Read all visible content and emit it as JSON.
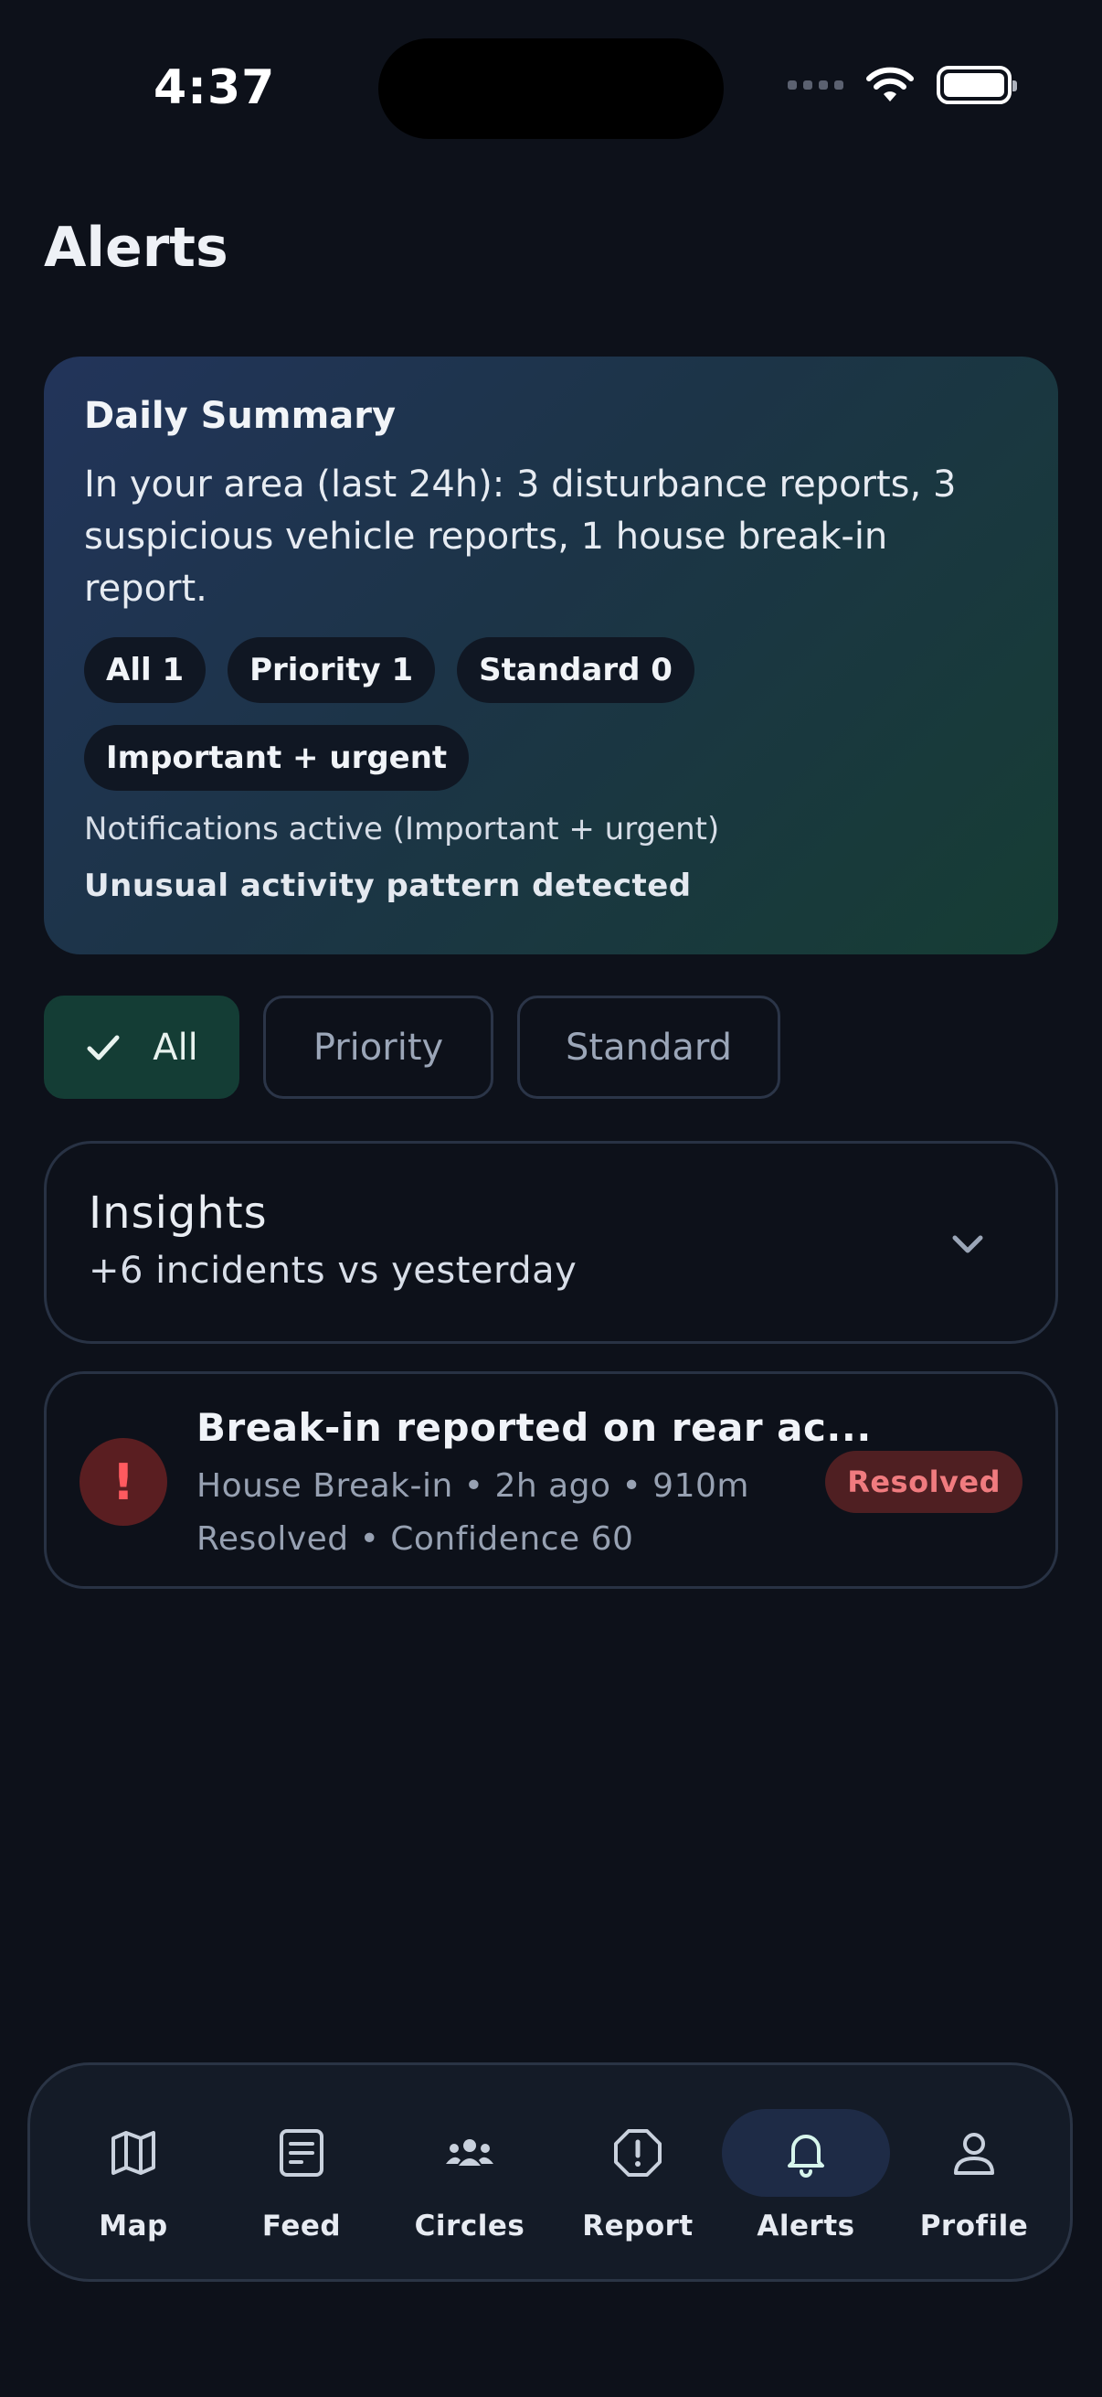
{
  "status_bar": {
    "time": "4:37"
  },
  "page": {
    "title": "Alerts"
  },
  "summary": {
    "title": "Daily Summary",
    "text": "In your area (last 24h): 3 disturbance reports, 3 suspicious vehicle reports, 1 house break-in report.",
    "chips": [
      "All 1",
      "Priority 1",
      "Standard 0",
      "Important + urgent"
    ],
    "notifications": "Notifications active (Important + urgent)",
    "unusual": "Unusual activity pattern detected"
  },
  "filters": [
    {
      "label": "All",
      "selected": true
    },
    {
      "label": "Priority",
      "selected": false
    },
    {
      "label": "Standard",
      "selected": false
    }
  ],
  "insights": {
    "title": "Insights",
    "subtitle": "+6 incidents vs yesterday"
  },
  "incidents": [
    {
      "icon": "!",
      "title": "Break-in reported on rear ac...",
      "meta": "House Break-in • 2h ago • 910m",
      "meta2": "Resolved • Confidence 60",
      "badge": "Resolved"
    }
  ],
  "nav": [
    {
      "label": "Map",
      "icon": "map-icon"
    },
    {
      "label": "Feed",
      "icon": "feed-icon"
    },
    {
      "label": "Circles",
      "icon": "circles-icon"
    },
    {
      "label": "Report",
      "icon": "report-icon"
    },
    {
      "label": "Alerts",
      "icon": "bell-icon",
      "active": true
    },
    {
      "label": "Profile",
      "icon": "profile-icon"
    }
  ],
  "colors": {
    "background": "#0d111a",
    "active_filter": "#143d35",
    "danger": "#ff5a5f",
    "badge_bg": "#4f1f22",
    "nav_active": "#1e2b46"
  }
}
